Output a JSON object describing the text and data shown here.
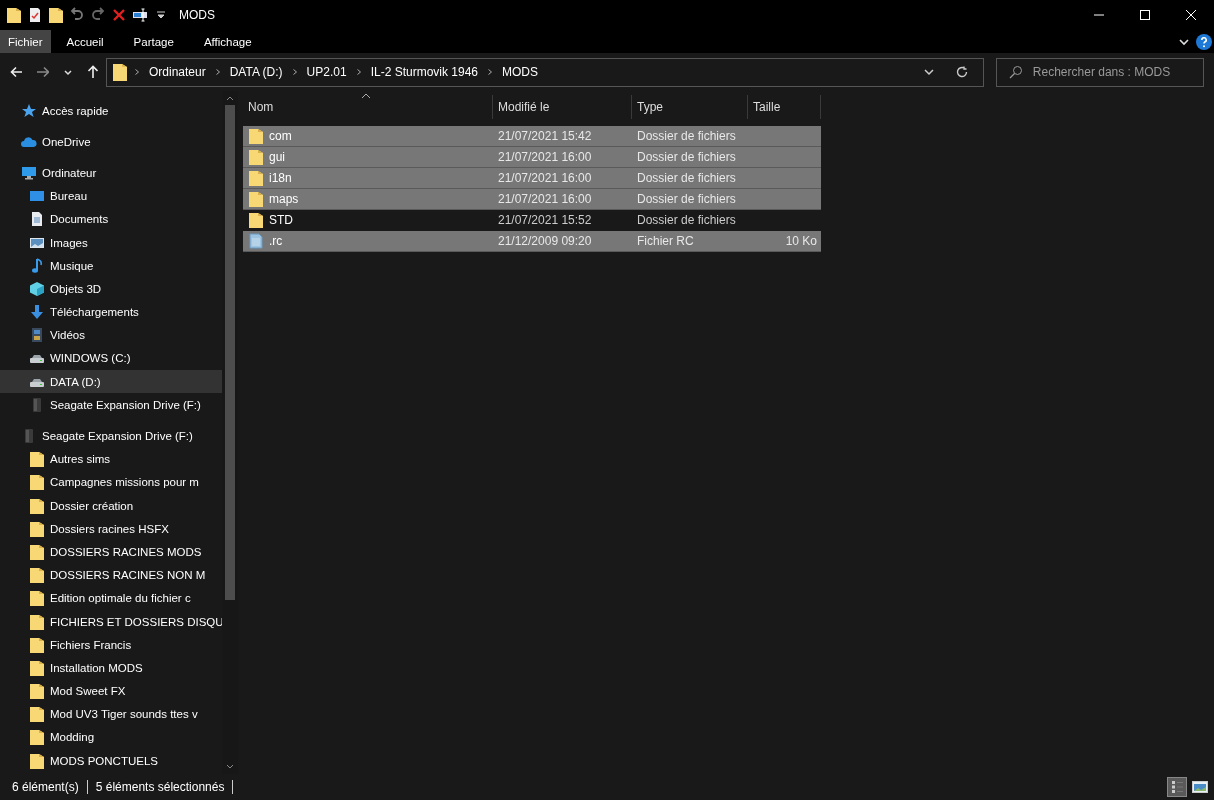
{
  "window": {
    "title": "MODS"
  },
  "ribbon_tabs": [
    {
      "label": "Fichier",
      "selected": true
    },
    {
      "label": "Accueil",
      "selected": false
    },
    {
      "label": "Partage",
      "selected": false
    },
    {
      "label": "Affichage",
      "selected": false
    }
  ],
  "address": {
    "path": [
      "Ordinateur",
      "DATA (D:)",
      "UP2.01",
      "IL-2 Sturmovik 1946",
      "MODS"
    ]
  },
  "search": {
    "placeholder": "Rechercher dans : MODS"
  },
  "sidebar": {
    "items": [
      {
        "label": "Accès rapide",
        "kind": "star",
        "selected": false
      },
      {
        "label": "OneDrive",
        "kind": "cloud",
        "selected": false
      },
      {
        "label": "Ordinateur",
        "kind": "pc",
        "selected": false,
        "children": [
          {
            "label": "Bureau",
            "kind": "desktop",
            "selected": false
          },
          {
            "label": "Documents",
            "kind": "doc",
            "selected": false
          },
          {
            "label": "Images",
            "kind": "image",
            "selected": false
          },
          {
            "label": "Musique",
            "kind": "music",
            "selected": false
          },
          {
            "label": "Objets 3D",
            "kind": "cube",
            "selected": false
          },
          {
            "label": "Téléchargements",
            "kind": "download",
            "selected": false
          },
          {
            "label": "Vidéos",
            "kind": "video",
            "selected": false
          },
          {
            "label": "WINDOWS (C:)",
            "kind": "drive",
            "selected": false
          },
          {
            "label": "DATA (D:)",
            "kind": "drive",
            "selected": true
          },
          {
            "label": "Seagate Expansion Drive (F:)",
            "kind": "ext",
            "selected": false
          }
        ]
      },
      {
        "label": "Seagate Expansion Drive (F:)",
        "kind": "ext",
        "selected": false,
        "children": [
          {
            "label": "Autres sims",
            "kind": "folder",
            "selected": false
          },
          {
            "label": "Campagnes missions pour m",
            "kind": "folder",
            "selected": false
          },
          {
            "label": "Dossier création",
            "kind": "folder",
            "selected": false
          },
          {
            "label": "Dossiers racines HSFX",
            "kind": "folder",
            "selected": false
          },
          {
            "label": "DOSSIERS RACINES MODS",
            "kind": "folder",
            "selected": false
          },
          {
            "label": "DOSSIERS RACINES NON M",
            "kind": "folder",
            "selected": false
          },
          {
            "label": "Edition optimale du fichier c",
            "kind": "folder",
            "selected": false
          },
          {
            "label": "FICHIERS ET DOSSIERS DISQU",
            "kind": "folder",
            "selected": false
          },
          {
            "label": "Fichiers Francis",
            "kind": "folder",
            "selected": false
          },
          {
            "label": "Installation MODS",
            "kind": "folder",
            "selected": false
          },
          {
            "label": "Mod Sweet FX",
            "kind": "folder",
            "selected": false
          },
          {
            "label": "Mod UV3 Tiger sounds ttes v",
            "kind": "folder",
            "selected": false
          },
          {
            "label": "Modding",
            "kind": "folder",
            "selected": false
          },
          {
            "label": "MODS PONCTUELS",
            "kind": "folder",
            "selected": false
          }
        ]
      }
    ]
  },
  "table": {
    "columns": [
      "Nom",
      "Modifié le",
      "Type",
      "Taille"
    ],
    "rows": [
      {
        "name": "com",
        "kind": "folder",
        "modified": "21/07/2021 15:42",
        "type": "Dossier de fichiers",
        "selected": true
      },
      {
        "name": "gui",
        "kind": "folder",
        "modified": "21/07/2021 16:00",
        "type": "Dossier de fichiers",
        "selected": true
      },
      {
        "name": "i18n",
        "kind": "folder",
        "modified": "21/07/2021 16:00",
        "type": "Dossier de fichiers",
        "selected": true
      },
      {
        "name": "maps",
        "kind": "folder",
        "modified": "21/07/2021 16:00",
        "type": "Dossier de fichiers",
        "selected": true
      },
      {
        "name": "STD",
        "kind": "folder",
        "modified": "21/07/2021 15:52",
        "type": "Dossier de fichiers",
        "selected": false
      },
      {
        "name": ".rc",
        "kind": "file",
        "modified": "21/12/2009 09:20",
        "type": "Fichier RC",
        "size": "10 Ko",
        "selected": true
      }
    ]
  },
  "status_bar": {
    "count": "6 élément(s)",
    "selection": "5 éléments sélectionnés"
  }
}
